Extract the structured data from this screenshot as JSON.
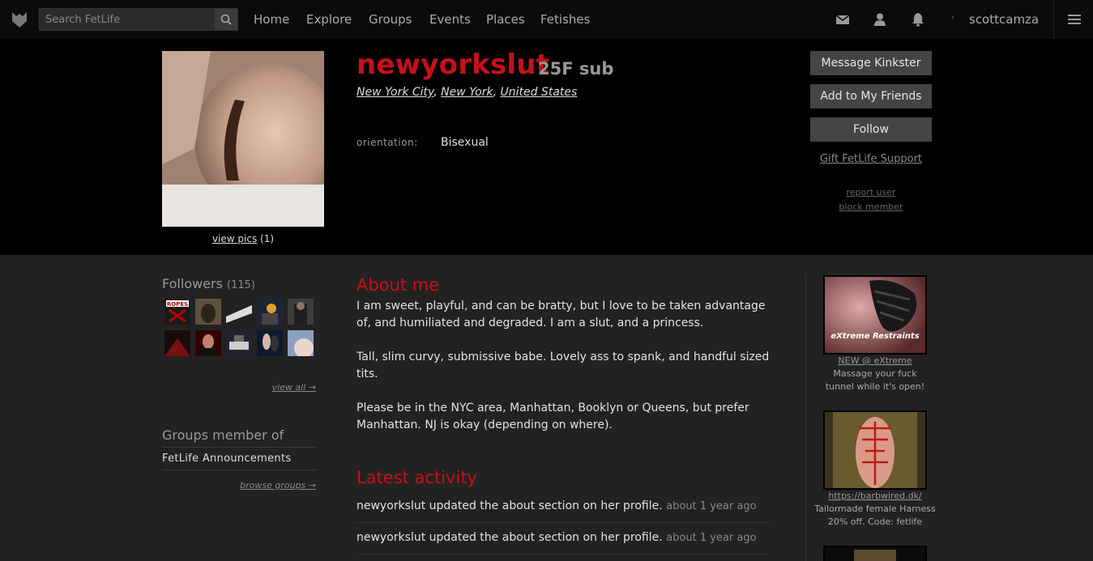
{
  "nav": {
    "search_placeholder": "Search FetLife",
    "links": [
      "Home",
      "Explore",
      "Groups",
      "Events",
      "Places",
      "Fetishes"
    ],
    "username": "scottcamza"
  },
  "profile": {
    "name": "newyorkslut",
    "meta": "25F sub",
    "location": {
      "city": "New York City",
      "state": "New York",
      "country": "United States"
    },
    "orientation_label": "orientation:",
    "orientation_value": "Bisexual",
    "view_pics_label": "view pics",
    "view_pics_count": "(1)",
    "actions": {
      "message": "Message Kinkster",
      "add_friend": "Add to My Friends",
      "follow": "Follow",
      "gift": "Gift FetLife Support",
      "report": "report user",
      "block": "block member"
    }
  },
  "sidebar": {
    "followers_title": "Followers",
    "followers_count": "(115)",
    "view_all": "view all →",
    "groups_title": "Groups member of",
    "groups": [
      "FetLife Announcements"
    ],
    "browse_groups": "browse groups →"
  },
  "about": {
    "title": "About me",
    "paragraphs": [
      "I am sweet, playful, and can be bratty, but I love to be taken advantage of, and humiliated and degraded. I am a slut, and a princess.",
      "Tall, slim curvy, submissive babe. Lovely ass to spank, and handful sized tits.",
      "Please be in the NYC area, Manhattan, Booklyn or Queens, but prefer Manhattan. NJ is okay (depending on where)."
    ]
  },
  "activity": {
    "title": "Latest activity",
    "items": [
      {
        "text": "newyorkslut updated the about section on her profile.",
        "when": "about 1 year ago"
      },
      {
        "text": "newyorkslut updated the about section on her profile.",
        "when": "about 1 year ago"
      }
    ]
  },
  "ads": [
    {
      "link": "NEW @ eXtreme",
      "line1": "Massage your fuck",
      "line2": "tunnel while it's open!",
      "logo_text": "eXtreme Restraints"
    },
    {
      "link": "https://barbwired.dk/",
      "line1": "Tailormade female Harness",
      "line2": "20% off. Code: fetlife"
    }
  ],
  "colors": {
    "accent_red": "#c7101a",
    "nav_bg": "#0b0b0b",
    "header_bg": "#000000",
    "page_bg": "#222222",
    "button_bg": "#444444"
  }
}
